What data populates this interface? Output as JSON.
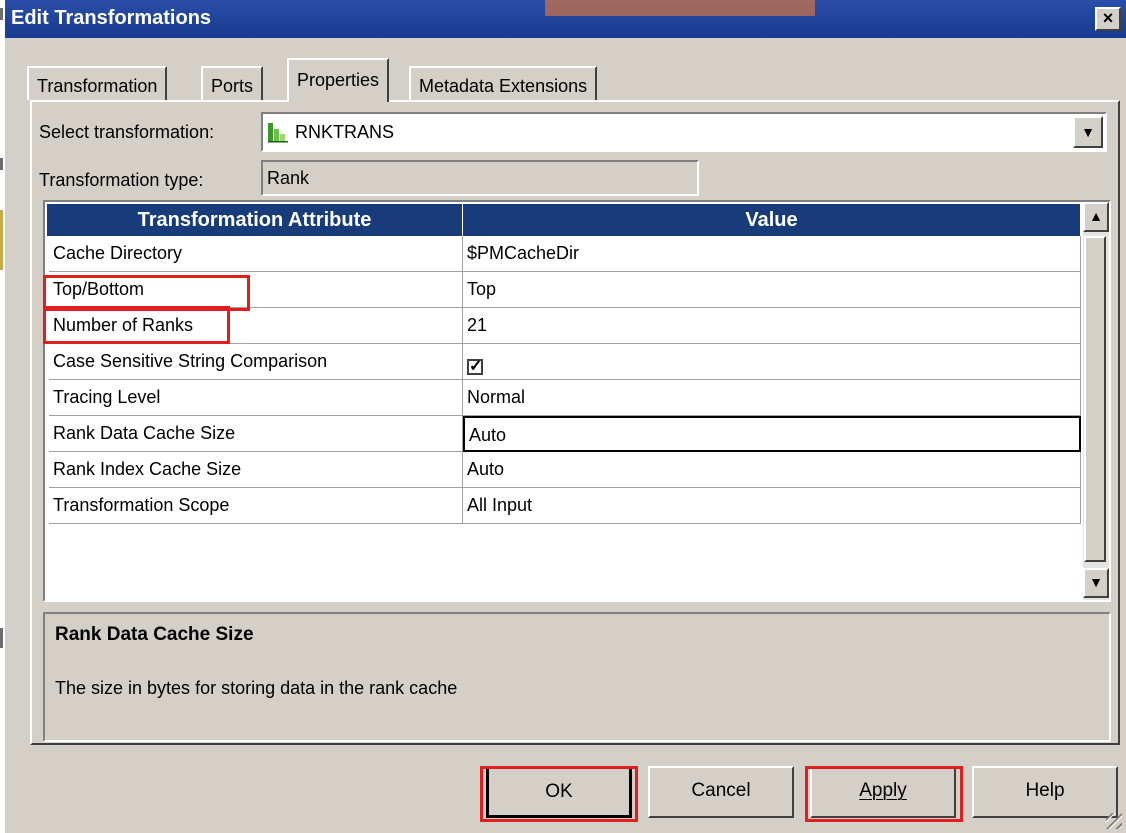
{
  "window": {
    "title": "Edit Transformations",
    "close_glyph": "×"
  },
  "tabs": [
    {
      "label": "Transformation",
      "active": false
    },
    {
      "label": "Ports",
      "active": false
    },
    {
      "label": "Properties",
      "active": true
    },
    {
      "label": "Metadata Extensions",
      "active": false
    }
  ],
  "select_transformation": {
    "label": "Select transformation:",
    "value": "RNKTRANS",
    "icon": "rank-transformation-icon"
  },
  "transformation_type": {
    "label": "Transformation type:",
    "value": "Rank"
  },
  "grid": {
    "headers": [
      "Transformation Attribute",
      "Value"
    ],
    "rows": [
      {
        "attribute": "Cache Directory",
        "value": "$PMCacheDir"
      },
      {
        "attribute": "Top/Bottom",
        "value": "Top"
      },
      {
        "attribute": "Number of Ranks",
        "value": "21"
      },
      {
        "attribute": "Case Sensitive String Comparison",
        "value": "",
        "checked": true
      },
      {
        "attribute": "Tracing Level",
        "value": "Normal"
      },
      {
        "attribute": "Rank Data Cache Size",
        "value": "Auto",
        "focused": true
      },
      {
        "attribute": "Rank Index Cache Size",
        "value": "Auto"
      },
      {
        "attribute": "Transformation Scope",
        "value": "All Input"
      }
    ]
  },
  "description": {
    "title": "Rank Data Cache Size",
    "text": "The size in bytes for storing data in the rank cache"
  },
  "buttons": {
    "ok": "OK",
    "cancel": "Cancel",
    "apply": "Apply",
    "help": "Help"
  },
  "colors": {
    "header_bg": "#183b7a",
    "highlight": "#e02020",
    "titlebar": "#1f43a0"
  }
}
